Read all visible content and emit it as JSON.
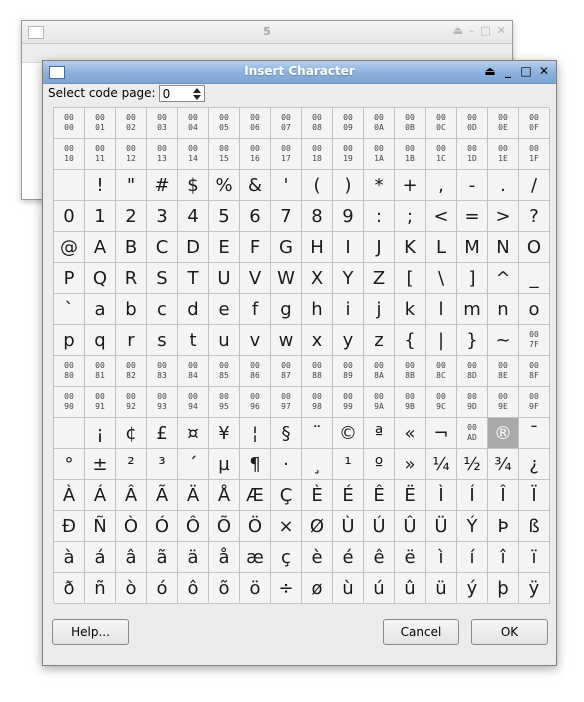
{
  "background_window": {
    "title": "5"
  },
  "dialog": {
    "title": "Insert Character",
    "controls": {
      "shade_icon": "shade-icon",
      "minimize_icon": "minimize-icon",
      "maximize_icon": "maximize-icon",
      "close_icon": "close-icon"
    },
    "code_page_label": "Select code page:",
    "code_page_value": "0",
    "selected_cell": "AE",
    "buttons": {
      "help": "Help...",
      "cancel": "Cancel",
      "ok": "OK"
    }
  },
  "grid": {
    "rows": [
      [
        "00\n00",
        "00\n01",
        "00\n02",
        "00\n03",
        "00\n04",
        "00\n05",
        "00\n06",
        "00\n07",
        "00\n08",
        "00\n09",
        "00\n0A",
        "00\n0B",
        "00\n0C",
        "00\n0D",
        "00\n0E",
        "00\n0F"
      ],
      [
        "00\n10",
        "00\n11",
        "00\n12",
        "00\n13",
        "00\n14",
        "00\n15",
        "00\n16",
        "00\n17",
        "00\n18",
        "00\n19",
        "00\n1A",
        "00\n1B",
        "00\n1C",
        "00\n1D",
        "00\n1E",
        "00\n1F"
      ],
      [
        " ",
        "!",
        "\"",
        "#",
        "$",
        "%",
        "&",
        "'",
        "(",
        ")",
        "*",
        "+",
        ",",
        "-",
        ".",
        "/"
      ],
      [
        "0",
        "1",
        "2",
        "3",
        "4",
        "5",
        "6",
        "7",
        "8",
        "9",
        ":",
        ";",
        "<",
        "=",
        ">",
        "?"
      ],
      [
        "@",
        "A",
        "B",
        "C",
        "D",
        "E",
        "F",
        "G",
        "H",
        "I",
        "J",
        "K",
        "L",
        "M",
        "N",
        "O"
      ],
      [
        "P",
        "Q",
        "R",
        "S",
        "T",
        "U",
        "V",
        "W",
        "X",
        "Y",
        "Z",
        "[",
        "\\",
        "]",
        "^",
        "_"
      ],
      [
        "`",
        "a",
        "b",
        "c",
        "d",
        "e",
        "f",
        "g",
        "h",
        "i",
        "j",
        "k",
        "l",
        "m",
        "n",
        "o"
      ],
      [
        "p",
        "q",
        "r",
        "s",
        "t",
        "u",
        "v",
        "w",
        "x",
        "y",
        "z",
        "{",
        "|",
        "}",
        "~",
        "00\n7F"
      ],
      [
        "00\n80",
        "00\n81",
        "00\n82",
        "00\n83",
        "00\n84",
        "00\n85",
        "00\n86",
        "00\n87",
        "00\n88",
        "00\n89",
        "00\n8A",
        "00\n8B",
        "00\n8C",
        "00\n8D",
        "00\n8E",
        "00\n8F"
      ],
      [
        "00\n90",
        "00\n91",
        "00\n92",
        "00\n93",
        "00\n94",
        "00\n95",
        "00\n96",
        "00\n97",
        "00\n98",
        "00\n99",
        "00\n9A",
        "00\n9B",
        "00\n9C",
        "00\n9D",
        "00\n9E",
        "00\n9F"
      ],
      [
        " ",
        "¡",
        "¢",
        "£",
        "¤",
        "¥",
        "¦",
        "§",
        "¨",
        "©",
        "ª",
        "«",
        "¬",
        "00\nAD",
        "®",
        "¯"
      ],
      [
        "°",
        "±",
        "²",
        "³",
        "´",
        "µ",
        "¶",
        "·",
        "¸",
        "¹",
        "º",
        "»",
        "¼",
        "½",
        "¾",
        "¿"
      ],
      [
        "À",
        "Á",
        "Â",
        "Ã",
        "Ä",
        "Å",
        "Æ",
        "Ç",
        "È",
        "É",
        "Ê",
        "Ë",
        "Ì",
        "Í",
        "Î",
        "Ï"
      ],
      [
        "Ð",
        "Ñ",
        "Ò",
        "Ó",
        "Ô",
        "Õ",
        "Ö",
        "×",
        "Ø",
        "Ù",
        "Ú",
        "Û",
        "Ü",
        "Ý",
        "Þ",
        "ß"
      ],
      [
        "à",
        "á",
        "â",
        "ã",
        "ä",
        "å",
        "æ",
        "ç",
        "è",
        "é",
        "ê",
        "ë",
        "ì",
        "í",
        "î",
        "ï"
      ],
      [
        "ð",
        "ñ",
        "ò",
        "ó",
        "ô",
        "õ",
        "ö",
        "÷",
        "ø",
        "ù",
        "ú",
        "û",
        "ü",
        "ý",
        "þ",
        "ÿ"
      ]
    ]
  }
}
